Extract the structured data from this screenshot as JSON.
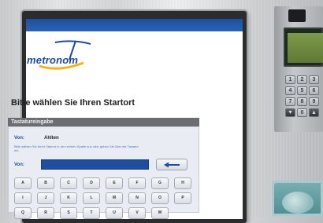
{
  "logo": {
    "brand_text": "metronom"
  },
  "screen": {
    "title": "Bitte wählen Sie Ihren Startort",
    "panel_header": "Tastatureingabe",
    "von_label": "Von:",
    "von_value": "Ahlten",
    "hint": "Bitte wählen Sie Ihren Startort in der rechten Spalte aus oder geben Sie über die Tastatur ein.",
    "input_label": "Von:",
    "input_value": "",
    "keyboard_rows": [
      [
        "A",
        "B",
        "C",
        "D",
        "E",
        "F",
        "G",
        "H"
      ],
      [
        "I",
        "J",
        "K",
        "L",
        "M",
        "N",
        "O",
        "P"
      ],
      [
        "Q",
        "R",
        "S",
        "T",
        "U",
        "V",
        "W"
      ]
    ]
  },
  "pinpad": {
    "rows": [
      [
        "1",
        "2",
        "3"
      ],
      [
        "4",
        "5",
        "6"
      ],
      [
        "7",
        "8",
        "9"
      ],
      [
        "▼",
        "0",
        "▲"
      ]
    ]
  },
  "colors": {
    "brand_blue": "#1f4d9c",
    "panel_header": "#6b6d70",
    "input_blue": "#1e4e9e"
  }
}
